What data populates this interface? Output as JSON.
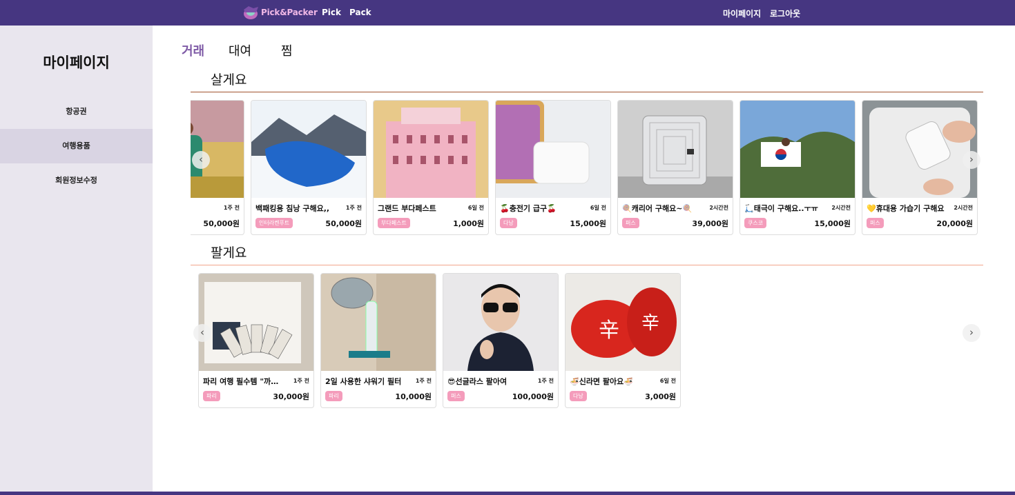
{
  "header": {
    "logo_text": "Pick&Packer",
    "nav": [
      "Pick",
      "Pack"
    ],
    "right_links": [
      "마이페이지",
      "로그아웃"
    ]
  },
  "sidebar": {
    "title": "마이페이지",
    "items": [
      {
        "label": "항공권",
        "active": false
      },
      {
        "label": "여행용품",
        "active": true
      },
      {
        "label": "회원정보수정",
        "active": false
      }
    ]
  },
  "tabs": [
    {
      "label": "거래",
      "active": true
    },
    {
      "label": "대여",
      "active": false
    },
    {
      "label": "찜",
      "active": false
    }
  ],
  "buy_section": {
    "title": "살게요",
    "line_color": "#a0522d",
    "items": [
      {
        "title": "",
        "time": "1주 전",
        "tag": "",
        "price": "50,000원",
        "image": "backpack-photo"
      },
      {
        "title": "백패킹용 침낭 구해요,,",
        "time": "1주 전",
        "tag": "인터라켄푸트",
        "price": "50,000원",
        "image": "sleeping-bag-photo"
      },
      {
        "title": "그랜드 부다페스트",
        "time": "6일 전",
        "tag": "부다페스트",
        "price": "1,000원",
        "image": "grand-hotel-photo"
      },
      {
        "title": "🍒충전기 급구🍒",
        "time": "6일 전",
        "tag": "다낭",
        "price": "15,000원",
        "image": "charger-photo"
      },
      {
        "title": "🍭캐리어 구해요~🍭",
        "time": "2시간전",
        "tag": "퍼스",
        "price": "39,000원",
        "image": "suitcase-photo"
      },
      {
        "title": "🛴태극이 구해요..ㅜㅠ",
        "time": "2시간전",
        "tag": "쿠스코",
        "price": "15,000원",
        "image": "flag-photo"
      },
      {
        "title": "💛휴대용 가습기 구해요",
        "time": "2시간전",
        "tag": "퍼스",
        "price": "20,000원",
        "image": "humidifier-photo"
      }
    ]
  },
  "sell_section": {
    "title": "팔게요",
    "line_color": "#f2a58a",
    "items": [
      {
        "title": "파리 여행 필수템 \"까르네\"",
        "time": "1주 전",
        "tag": "파리",
        "price": "30,000원",
        "image": "metro-tickets-photo"
      },
      {
        "title": "2일 사용한 샤워기 필터",
        "time": "1주 전",
        "tag": "파리",
        "price": "10,000원",
        "image": "shower-head-photo"
      },
      {
        "title": "😎선글라스 팔아여",
        "time": "1주 전",
        "tag": "퍼스",
        "price": "100,000원",
        "image": "sunglasses-man-photo"
      },
      {
        "title": "🍜신라면 팔아요🍜",
        "time": "6일 전",
        "tag": "다낭",
        "price": "3,000원",
        "image": "shin-ramyun-photo"
      }
    ]
  },
  "colors": {
    "header_bg": "#463681",
    "sidebar_bg": "#e9e6ee",
    "sidebar_active_bg": "#d9d4e3",
    "tab_active": "#7e5aa6",
    "tag_bg": "#f49cbb"
  }
}
